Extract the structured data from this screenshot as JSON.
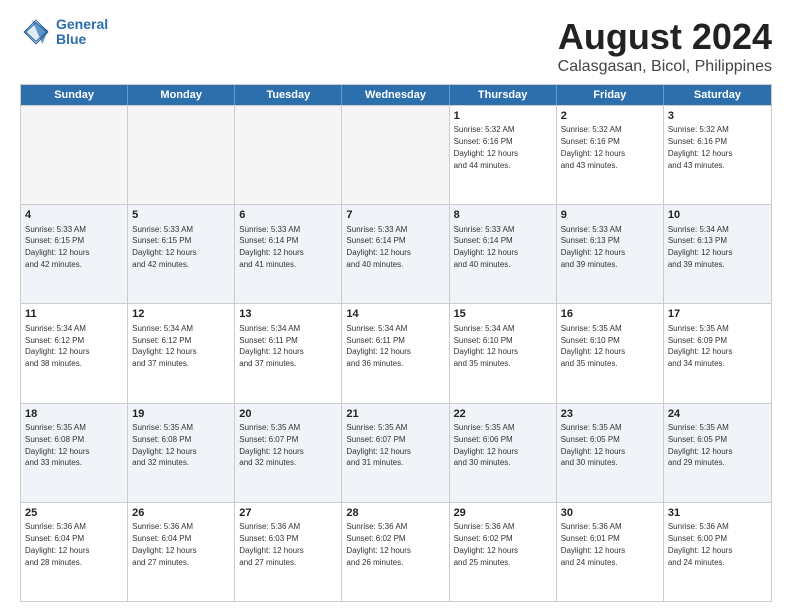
{
  "logo": {
    "line1": "General",
    "line2": "Blue"
  },
  "title": "August 2024",
  "subtitle": "Calasgasan, Bicol, Philippines",
  "header_days": [
    "Sunday",
    "Monday",
    "Tuesday",
    "Wednesday",
    "Thursday",
    "Friday",
    "Saturday"
  ],
  "rows": [
    [
      {
        "day": "",
        "info": "",
        "empty": true
      },
      {
        "day": "",
        "info": "",
        "empty": true
      },
      {
        "day": "",
        "info": "",
        "empty": true
      },
      {
        "day": "",
        "info": "",
        "empty": true
      },
      {
        "day": "1",
        "info": "Sunrise: 5:32 AM\nSunset: 6:16 PM\nDaylight: 12 hours\nand 44 minutes."
      },
      {
        "day": "2",
        "info": "Sunrise: 5:32 AM\nSunset: 6:16 PM\nDaylight: 12 hours\nand 43 minutes."
      },
      {
        "day": "3",
        "info": "Sunrise: 5:32 AM\nSunset: 6:16 PM\nDaylight: 12 hours\nand 43 minutes."
      }
    ],
    [
      {
        "day": "4",
        "info": "Sunrise: 5:33 AM\nSunset: 6:15 PM\nDaylight: 12 hours\nand 42 minutes."
      },
      {
        "day": "5",
        "info": "Sunrise: 5:33 AM\nSunset: 6:15 PM\nDaylight: 12 hours\nand 42 minutes."
      },
      {
        "day": "6",
        "info": "Sunrise: 5:33 AM\nSunset: 6:14 PM\nDaylight: 12 hours\nand 41 minutes."
      },
      {
        "day": "7",
        "info": "Sunrise: 5:33 AM\nSunset: 6:14 PM\nDaylight: 12 hours\nand 40 minutes."
      },
      {
        "day": "8",
        "info": "Sunrise: 5:33 AM\nSunset: 6:14 PM\nDaylight: 12 hours\nand 40 minutes."
      },
      {
        "day": "9",
        "info": "Sunrise: 5:33 AM\nSunset: 6:13 PM\nDaylight: 12 hours\nand 39 minutes."
      },
      {
        "day": "10",
        "info": "Sunrise: 5:34 AM\nSunset: 6:13 PM\nDaylight: 12 hours\nand 39 minutes."
      }
    ],
    [
      {
        "day": "11",
        "info": "Sunrise: 5:34 AM\nSunset: 6:12 PM\nDaylight: 12 hours\nand 38 minutes."
      },
      {
        "day": "12",
        "info": "Sunrise: 5:34 AM\nSunset: 6:12 PM\nDaylight: 12 hours\nand 37 minutes."
      },
      {
        "day": "13",
        "info": "Sunrise: 5:34 AM\nSunset: 6:11 PM\nDaylight: 12 hours\nand 37 minutes."
      },
      {
        "day": "14",
        "info": "Sunrise: 5:34 AM\nSunset: 6:11 PM\nDaylight: 12 hours\nand 36 minutes."
      },
      {
        "day": "15",
        "info": "Sunrise: 5:34 AM\nSunset: 6:10 PM\nDaylight: 12 hours\nand 35 minutes."
      },
      {
        "day": "16",
        "info": "Sunrise: 5:35 AM\nSunset: 6:10 PM\nDaylight: 12 hours\nand 35 minutes."
      },
      {
        "day": "17",
        "info": "Sunrise: 5:35 AM\nSunset: 6:09 PM\nDaylight: 12 hours\nand 34 minutes."
      }
    ],
    [
      {
        "day": "18",
        "info": "Sunrise: 5:35 AM\nSunset: 6:08 PM\nDaylight: 12 hours\nand 33 minutes."
      },
      {
        "day": "19",
        "info": "Sunrise: 5:35 AM\nSunset: 6:08 PM\nDaylight: 12 hours\nand 32 minutes."
      },
      {
        "day": "20",
        "info": "Sunrise: 5:35 AM\nSunset: 6:07 PM\nDaylight: 12 hours\nand 32 minutes."
      },
      {
        "day": "21",
        "info": "Sunrise: 5:35 AM\nSunset: 6:07 PM\nDaylight: 12 hours\nand 31 minutes."
      },
      {
        "day": "22",
        "info": "Sunrise: 5:35 AM\nSunset: 6:06 PM\nDaylight: 12 hours\nand 30 minutes."
      },
      {
        "day": "23",
        "info": "Sunrise: 5:35 AM\nSunset: 6:05 PM\nDaylight: 12 hours\nand 30 minutes."
      },
      {
        "day": "24",
        "info": "Sunrise: 5:35 AM\nSunset: 6:05 PM\nDaylight: 12 hours\nand 29 minutes."
      }
    ],
    [
      {
        "day": "25",
        "info": "Sunrise: 5:36 AM\nSunset: 6:04 PM\nDaylight: 12 hours\nand 28 minutes."
      },
      {
        "day": "26",
        "info": "Sunrise: 5:36 AM\nSunset: 6:04 PM\nDaylight: 12 hours\nand 27 minutes."
      },
      {
        "day": "27",
        "info": "Sunrise: 5:36 AM\nSunset: 6:03 PM\nDaylight: 12 hours\nand 27 minutes."
      },
      {
        "day": "28",
        "info": "Sunrise: 5:36 AM\nSunset: 6:02 PM\nDaylight: 12 hours\nand 26 minutes."
      },
      {
        "day": "29",
        "info": "Sunrise: 5:36 AM\nSunset: 6:02 PM\nDaylight: 12 hours\nand 25 minutes."
      },
      {
        "day": "30",
        "info": "Sunrise: 5:36 AM\nSunset: 6:01 PM\nDaylight: 12 hours\nand 24 minutes."
      },
      {
        "day": "31",
        "info": "Sunrise: 5:36 AM\nSunset: 6:00 PM\nDaylight: 12 hours\nand 24 minutes."
      }
    ]
  ]
}
